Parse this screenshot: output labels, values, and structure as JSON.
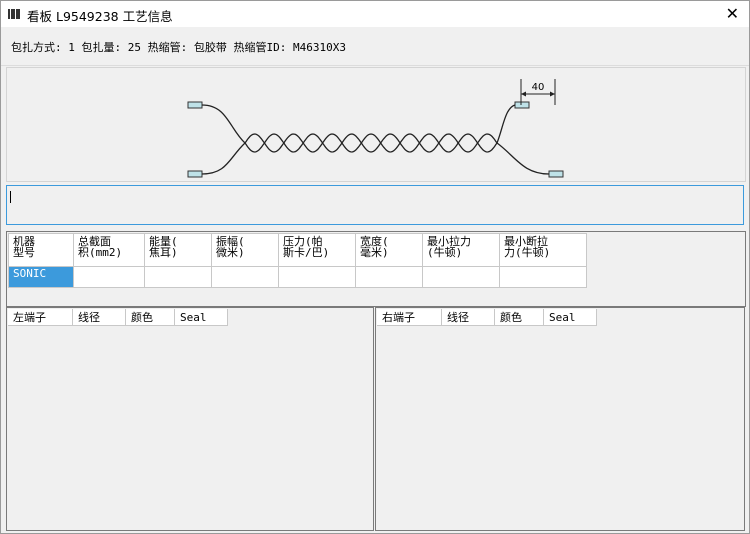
{
  "window": {
    "title": "看板 L9549238 工艺信息",
    "close_label": "✕"
  },
  "info": {
    "text": "包扎方式: 1 包扎量: 25 热缩管: 包胶带 热缩管ID: M46310X3"
  },
  "diagram": {
    "dimension_label": "40"
  },
  "input": {
    "value": ""
  },
  "params": {
    "headers": [
      [
        "机器",
        "型号"
      ],
      [
        "总截面",
        "积(mm2)"
      ],
      [
        "能量(",
        "焦耳)"
      ],
      [
        "振幅(",
        "微米)"
      ],
      [
        "压力(帕",
        "斯卡/巴)"
      ],
      [
        "宽度(",
        "毫米)"
      ],
      [
        "最小拉力",
        "(牛顿)"
      ],
      [
        "最小断拉",
        "力(牛顿)"
      ]
    ],
    "row": [
      "SONIC",
      "",
      "",
      "",
      "",
      "",
      "",
      ""
    ]
  },
  "left_panel": {
    "columns": [
      "左端子",
      "线径",
      "颜色",
      "Seal"
    ]
  },
  "right_panel": {
    "columns": [
      "右端子",
      "线径",
      "颜色",
      "Seal"
    ]
  }
}
